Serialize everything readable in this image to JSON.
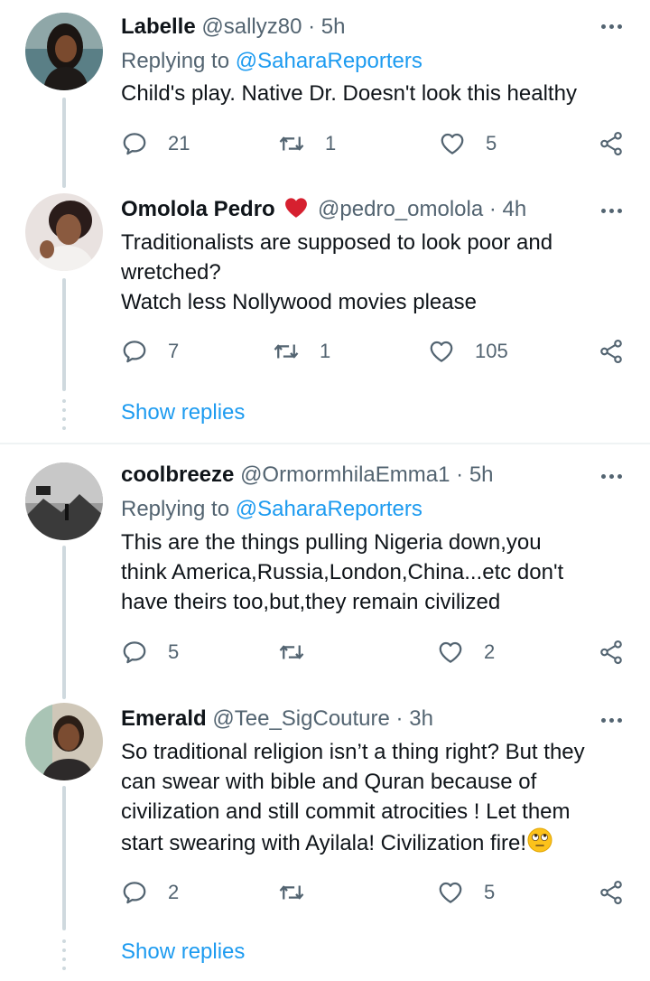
{
  "tweets": [
    {
      "name": "Labelle",
      "handle": "@sallyz80",
      "separator": "·",
      "time": "5h",
      "replying_prefix": "Replying to ",
      "replying_to": "@SaharaReporters",
      "lines": [
        "Child's play. Native Dr. Doesn't look this healthy"
      ],
      "replies": "21",
      "retweets": "1",
      "likes": "5"
    },
    {
      "name": "Omolola Pedro",
      "handle": "@pedro_omolola",
      "separator": "·",
      "time": "4h",
      "lines": [
        "Traditionalists are supposed to look poor and",
        "wretched?",
        "Watch less Nollywood movies please"
      ],
      "replies": "7",
      "retweets": "1",
      "likes": "105",
      "show_replies": "Show replies"
    },
    {
      "name": "coolbreeze",
      "handle": "@OrmormhilaEmma1",
      "separator": "·",
      "time": "5h",
      "replying_prefix": "Replying to ",
      "replying_to": "@SaharaReporters",
      "lines": [
        "This are the things pulling Nigeria down,you",
        "think America,Russia,London,China...etc don't",
        "have theirs too,but,they remain civilized"
      ],
      "replies": "5",
      "retweets": "",
      "likes": "2"
    },
    {
      "name": "Emerald",
      "handle": "@Tee_SigCouture",
      "separator": "·",
      "time": "3h",
      "lines": [
        "So traditional religion isn’t a thing right? But they",
        "can swear with bible and Quran because of",
        "civilization and still commit atrocities ! Let them",
        "start swearing with Ayilala! Civilization fire!"
      ],
      "replies": "2",
      "retweets": "",
      "likes": "5",
      "show_replies": "Show replies"
    }
  ],
  "icons": {
    "reply": "reply-icon",
    "retweet": "retweet-icon",
    "like": "heart-icon",
    "share": "share-icon",
    "more": "more-icon",
    "badge": "red-heart-emoji",
    "eye_roll": "face-with-rolling-eyes-emoji"
  },
  "colors": {
    "text": "#0f1419",
    "secondary": "#536471",
    "link": "#1d9bf0",
    "thread_line": "#cfd9de",
    "badge_red": "#d6202f"
  }
}
